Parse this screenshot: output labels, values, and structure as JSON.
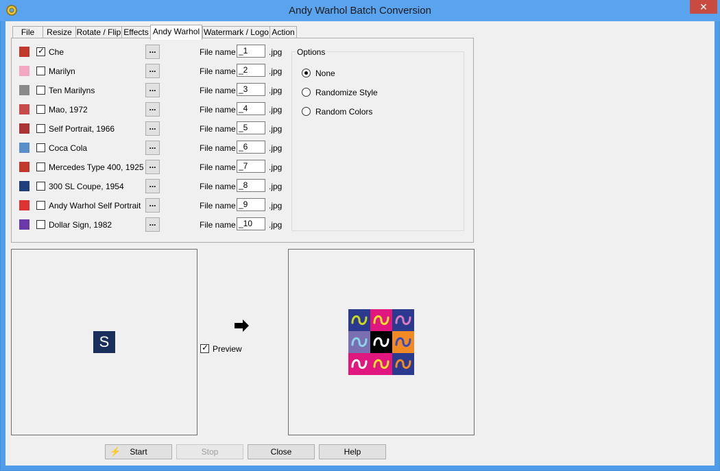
{
  "window": {
    "title": "Andy Warhol Batch Conversion"
  },
  "tabs": [
    {
      "label": "File"
    },
    {
      "label": "Resize"
    },
    {
      "label": "Rotate / Flip"
    },
    {
      "label": "Effects"
    },
    {
      "label": "Andy Warhol"
    },
    {
      "label": "Watermark / Logo"
    },
    {
      "label": "Action"
    }
  ],
  "styles": {
    "browse_label": "...",
    "file_name_label": "File name",
    "extension": ".jpg",
    "items": [
      {
        "name": "Che",
        "checked": true,
        "file_name": "_1"
      },
      {
        "name": "Marilyn",
        "checked": false,
        "file_name": "_2"
      },
      {
        "name": "Ten Marilyns",
        "checked": false,
        "file_name": "_3"
      },
      {
        "name": "Mao, 1972",
        "checked": false,
        "file_name": "_4"
      },
      {
        "name": "Self Portrait, 1966",
        "checked": false,
        "file_name": "_5"
      },
      {
        "name": "Coca Cola",
        "checked": false,
        "file_name": "_6"
      },
      {
        "name": "Mercedes Type 400, 1925",
        "checked": false,
        "file_name": "_7"
      },
      {
        "name": "300 SL Coupe, 1954",
        "checked": false,
        "file_name": "_8"
      },
      {
        "name": "Andy Warhol Self Portrait",
        "checked": false,
        "file_name": "_9"
      },
      {
        "name": "Dollar Sign, 1982",
        "checked": false,
        "file_name": "_10"
      }
    ]
  },
  "options": {
    "title": "Options",
    "choices": [
      {
        "label": "None",
        "selected": true
      },
      {
        "label": "Randomize Style",
        "selected": false
      },
      {
        "label": "Random Colors",
        "selected": false
      }
    ]
  },
  "preview": {
    "label": "Preview",
    "checked": true,
    "source_letter": "S"
  },
  "buttons": {
    "start": "Start",
    "stop": "Stop",
    "close": "Close",
    "help": "Help"
  },
  "colors": {
    "titlebar": "#5aa3ee",
    "close": "#c74b40",
    "source_tile": "#1a2f5c"
  }
}
